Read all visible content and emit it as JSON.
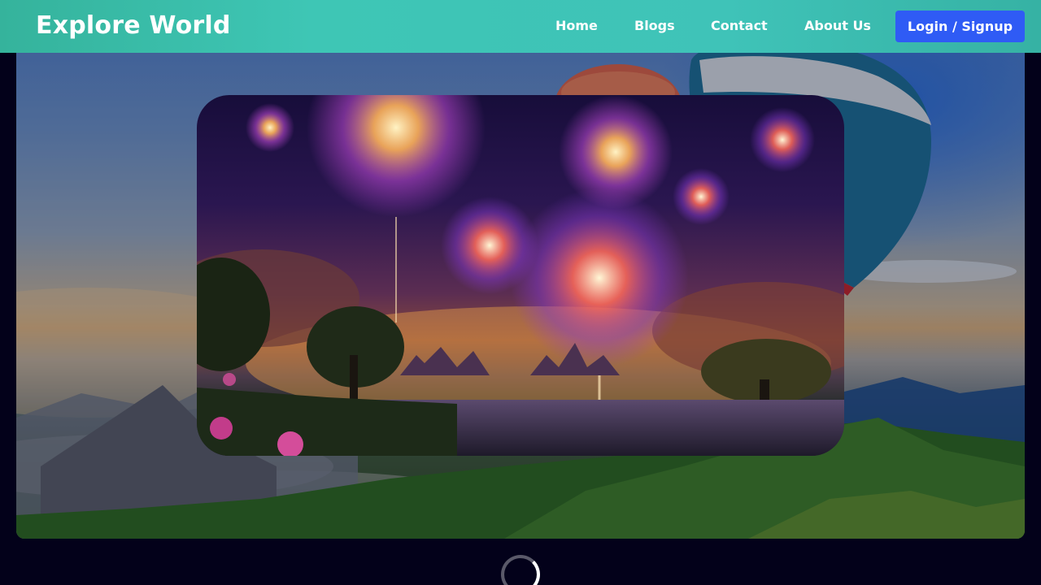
{
  "navbar": {
    "brand": "Explore World",
    "links": [
      {
        "label": "Home"
      },
      {
        "label": "Blogs"
      },
      {
        "label": "Contact"
      },
      {
        "label": "About Us"
      }
    ],
    "login_label": "Login / Signup"
  },
  "images": {
    "hero_background": "hot-air-balloons-over-mountains",
    "feature_card": "fireworks-over-lake-landscape"
  },
  "loading_indicator": "spinner-icon",
  "colors": {
    "navbar": "#3ec6b5",
    "login_button": "#2f5bf5",
    "page_background": "#03011a"
  }
}
